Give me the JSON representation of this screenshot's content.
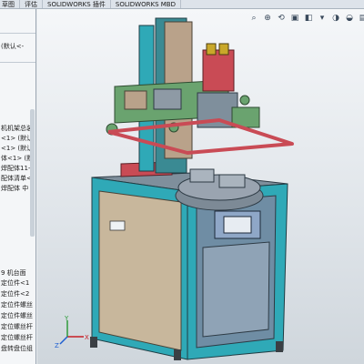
{
  "tabs": [
    "草图",
    "评估",
    "SOLIDWORKS 插件",
    "SOLIDWORKS MBD"
  ],
  "tree": {
    "top": "(默认<-",
    "items": [
      "机机架总装",
      "<1> (默认",
      "<1> (默认",
      "体<1> (默",
      "焊配体11-",
      "配体清单<",
      "焊配体 中",
      "9 机台面",
      "定位件<1",
      "定位件<2",
      "定位件螺丝",
      "定位件螺丝",
      "定位螺丝杆",
      "定位螺丝杆",
      "盘转盘位组"
    ]
  },
  "hud": {
    "icons": [
      "search-icon",
      "zoom-icon",
      "rotate-icon",
      "section-icon",
      "display-style-icon",
      "view-orientation-icon",
      "hide-show-icon",
      "appearance-icon",
      "scene-icon",
      "record-icon"
    ],
    "glyphs": [
      "⌕",
      "⊕",
      "⟲",
      "▣",
      "◧",
      "▾",
      "◑",
      "◒",
      "▤",
      "●"
    ]
  },
  "model": {
    "frame_color": "#2fa9b7",
    "panel_color": "#c8b79c",
    "post_color": "#3a8a93",
    "plate_color": "#6f8da4",
    "rail_color": "#c94b55",
    "bracket_color": "#b9a28a",
    "green_color": "#6aa36f",
    "table_color": "#9aa4b0"
  },
  "triad": {
    "x": "X",
    "y": "Y",
    "z": "Z"
  }
}
